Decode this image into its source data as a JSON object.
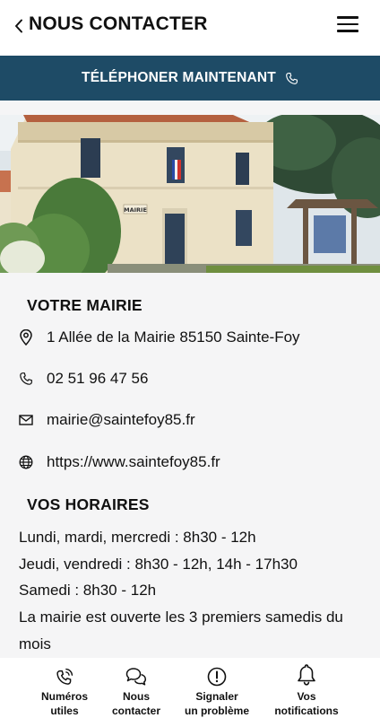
{
  "header": {
    "title": "NOUS CONTACTER",
    "back_icon": "chevron-left-icon",
    "menu_icon": "hamburger-menu-icon"
  },
  "call_bar": {
    "label": "TÉLÉPHONER MAINTENANT",
    "icon": "phone-icon",
    "background": "#1e4b66"
  },
  "photo": {
    "sign_text": "MAIRIE"
  },
  "mairie": {
    "heading": "VOTRE MAIRIE",
    "address": "1 Allée de la Mairie 85150 Sainte-Foy",
    "phone": "02 51 96 47 56",
    "email": "mairie@saintefoy85.fr",
    "website": "https://www.saintefoy85.fr"
  },
  "horaires": {
    "heading": "VOS HORAIRES",
    "lines": [
      "Lundi, mardi, mercredi : 8h30 - 12h",
      "Jeudi, vendredi : 8h30 - 12h, 14h - 17h30",
      "Samedi : 8h30 - 12h",
      "La mairie est ouverte les 3 premiers samedis du mois"
    ]
  },
  "bottom_nav": {
    "items": [
      {
        "label": "Numéros\nutiles",
        "icon": "phone-ringing-icon"
      },
      {
        "label": "Nous\ncontacter",
        "icon": "chat-bubbles-icon"
      },
      {
        "label": "Signaler\nun problème",
        "icon": "alert-circle-icon"
      },
      {
        "label": "Vos\nnotifications",
        "icon": "bell-icon"
      }
    ]
  }
}
